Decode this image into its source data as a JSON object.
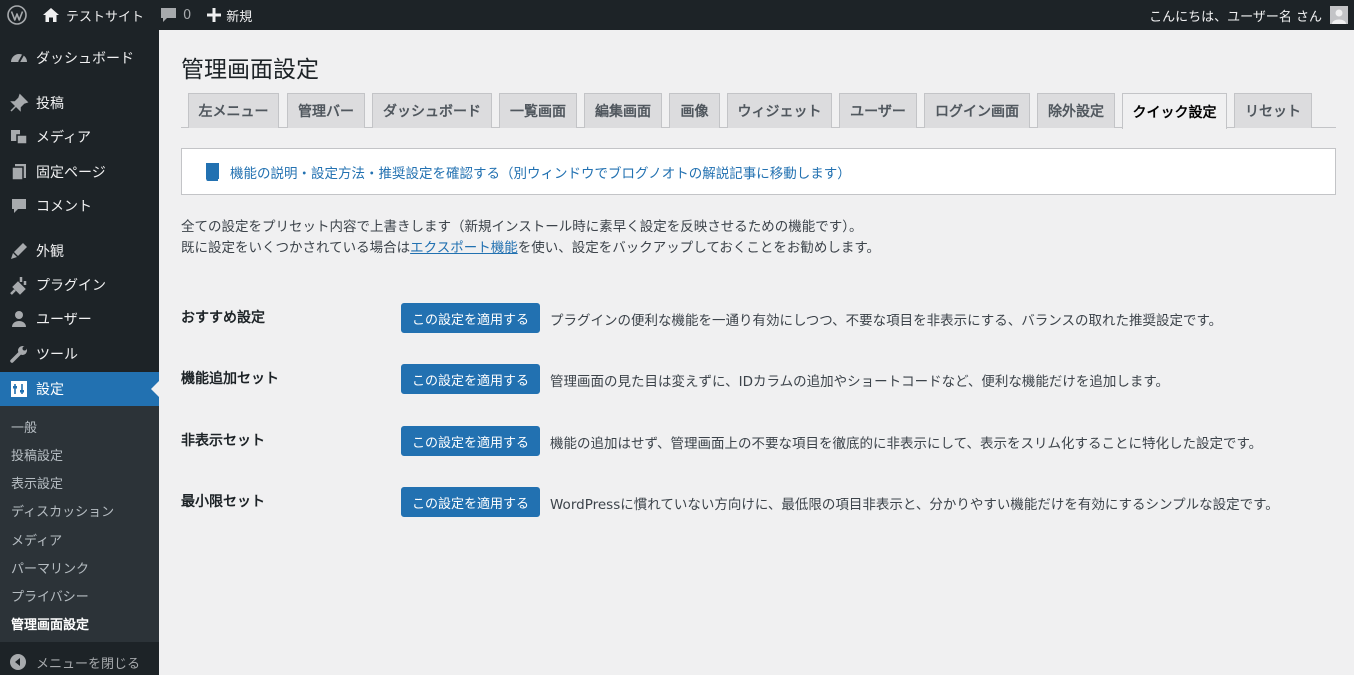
{
  "adminbar": {
    "site_name": "テストサイト",
    "comments_count": "0",
    "new_label": "新規",
    "greeting": "こんにちは、ユーザー名 さん"
  },
  "sidebar": {
    "items": [
      {
        "label": "ダッシュボード",
        "icon": "dashboard-icon"
      },
      {
        "label": "投稿",
        "icon": "pin-icon"
      },
      {
        "label": "メディア",
        "icon": "media-icon"
      },
      {
        "label": "固定ページ",
        "icon": "page-icon"
      },
      {
        "label": "コメント",
        "icon": "comment-icon"
      },
      {
        "label": "外観",
        "icon": "appearance-icon"
      },
      {
        "label": "プラグイン",
        "icon": "plugin-icon"
      },
      {
        "label": "ユーザー",
        "icon": "user-icon"
      },
      {
        "label": "ツール",
        "icon": "tool-icon"
      },
      {
        "label": "設定",
        "icon": "settings-icon"
      }
    ],
    "submenu": [
      "一般",
      "投稿設定",
      "表示設定",
      "ディスカッション",
      "メディア",
      "パーマリンク",
      "プライバシー",
      "管理画面設定"
    ],
    "collapse_label": "メニューを閉じる"
  },
  "main": {
    "title": "管理画面設定",
    "tabs": [
      "左メニュー",
      "管理バー",
      "ダッシュボード",
      "一覧画面",
      "編集画面",
      "画像",
      "ウィジェット",
      "ユーザー",
      "ログイン画面",
      "除外設定",
      "クイック設定",
      "リセット"
    ],
    "active_tab": "クイック設定",
    "notice_link": "機能の説明・設定方法・推奨設定を確認する（別ウィンドウでブログノオトの解説記事に移動します）",
    "desc_line1": "全ての設定をプリセット内容で上書きします（新規インストール時に素早く設定を反映させるための機能です）。",
    "desc_line2_before": "既に設定をいくつかされている場合は",
    "desc_line2_link": "エクスポート機能",
    "desc_line2_after": "を使い、設定をバックアップしておくことをお勧めします。",
    "presets": [
      {
        "label": "おすすめ設定",
        "button": "この設定を適用する",
        "desc": "プラグインの便利な機能を一通り有効にしつつ、不要な項目を非表示にする、バランスの取れた推奨設定です。"
      },
      {
        "label": "機能追加セット",
        "button": "この設定を適用する",
        "desc": "管理画面の見た目は変えずに、IDカラムの追加やショートコードなど、便利な機能だけを追加します。"
      },
      {
        "label": "非表示セット",
        "button": "この設定を適用する",
        "desc": "機能の追加はせず、管理画面上の不要な項目を徹底的に非表示にして、表示をスリム化することに特化した設定です。"
      },
      {
        "label": "最小限セット",
        "button": "この設定を適用する",
        "desc": "WordPressに慣れていない方向けに、最低限の項目非表示と、分かりやすい機能だけを有効にするシンプルな設定です。"
      }
    ]
  }
}
